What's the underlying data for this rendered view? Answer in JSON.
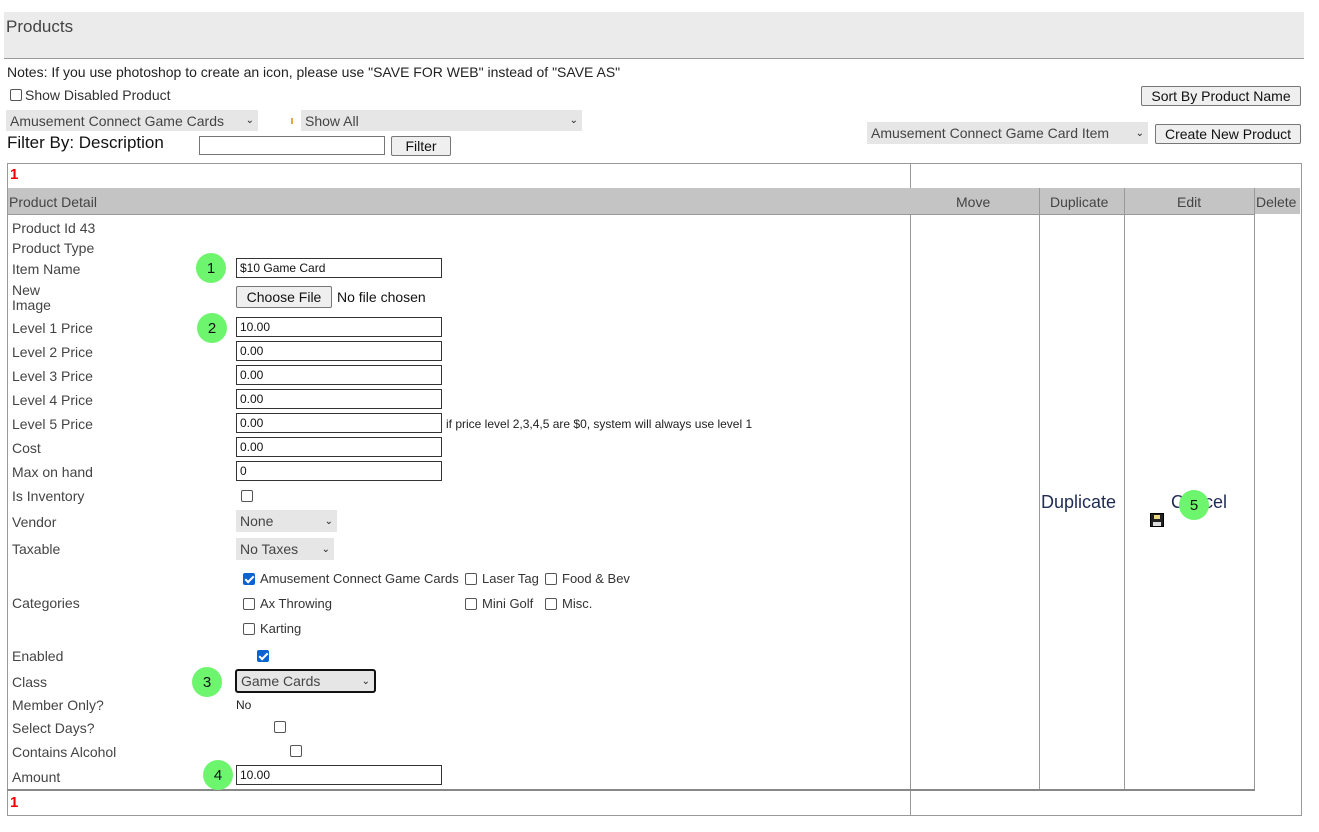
{
  "page": {
    "title": "Products"
  },
  "notes": "Notes: If you use photoshop to create an icon, please use \"SAVE FOR WEB\" instead of \"SAVE AS\"",
  "show_disabled": {
    "label": "Show Disabled Product",
    "checked": false
  },
  "toolbar": {
    "sort_button": "Sort By Product Name",
    "category_select": "Amusement Connect Game Cards",
    "filter_select": "Show All",
    "item_type_select": "Amusement Connect Game Card Item",
    "create_button": "Create New Product"
  },
  "filter": {
    "label": "Filter By: Description",
    "value": "",
    "button": "Filter"
  },
  "pagination": {
    "top": "1",
    "bottom": "1"
  },
  "table": {
    "headers": {
      "detail": "Product Detail",
      "move": "Move",
      "duplicate": "Duplicate",
      "edit": "Edit",
      "delete": "Delete"
    }
  },
  "product": {
    "id_label": "Product Id 43",
    "type_label": "Product Type",
    "item_name": {
      "label": "Item Name",
      "value": "$10 Game Card"
    },
    "new_image": {
      "label_line1": "New",
      "label_line2": "Image",
      "button": "Choose File",
      "status": "No file chosen"
    },
    "level1": {
      "label": "Level 1 Price",
      "value": "10.00"
    },
    "level2": {
      "label": "Level 2 Price",
      "value": "0.00"
    },
    "level3": {
      "label": "Level 3 Price",
      "value": "0.00"
    },
    "level4": {
      "label": "Level 4 Price",
      "value": "0.00"
    },
    "level5": {
      "label": "Level 5 Price",
      "value": "0.00",
      "hint": "if price level 2,3,4,5 are $0, system will always use level 1"
    },
    "cost": {
      "label": "Cost",
      "value": "0.00"
    },
    "max_on_hand": {
      "label": "Max on hand",
      "value": "0"
    },
    "is_inventory": {
      "label": "Is Inventory",
      "checked": false
    },
    "vendor": {
      "label": "Vendor",
      "value": "None"
    },
    "taxable": {
      "label": "Taxable",
      "value": "No Taxes"
    },
    "categories": {
      "label": "Categories",
      "options": [
        {
          "name": "Amusement Connect Game Cards",
          "checked": true
        },
        {
          "name": "Laser Tag",
          "checked": false
        },
        {
          "name": "Food & Bev",
          "checked": false
        },
        {
          "name": "Ax Throwing",
          "checked": false
        },
        {
          "name": "Mini Golf",
          "checked": false
        },
        {
          "name": "Misc.",
          "checked": false
        },
        {
          "name": "Karting",
          "checked": false
        }
      ]
    },
    "enabled": {
      "label": "Enabled",
      "checked": true
    },
    "class": {
      "label": "Class",
      "value": "Game Cards"
    },
    "member_only": {
      "label": "Member Only?",
      "value": "No"
    },
    "select_days": {
      "label": "Select Days?",
      "checked": false
    },
    "contains_alcohol": {
      "label": "Contains Alcohol",
      "checked": false
    },
    "amount": {
      "label": "Amount",
      "value": "10.00"
    }
  },
  "actions": {
    "duplicate": "Duplicate",
    "cancel": "Cancel"
  },
  "annotations": [
    "1",
    "2",
    "3",
    "4",
    "5"
  ],
  "colors": {
    "badge": "#6ef56e",
    "header_bg": "#c4c4c4",
    "page_red": "#e00000",
    "link": "#1f2b55"
  }
}
